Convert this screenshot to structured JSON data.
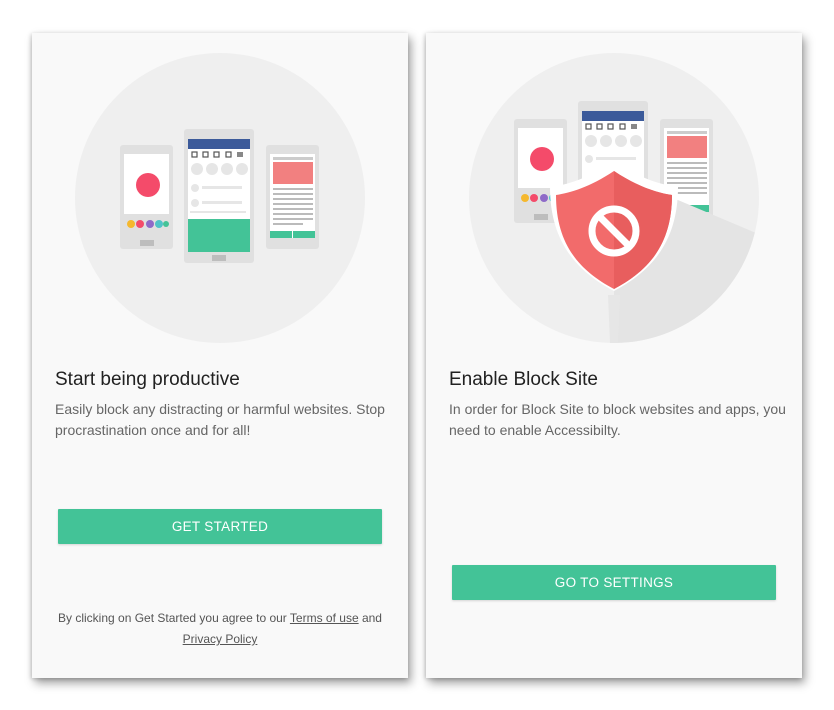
{
  "colors": {
    "accent": "#43c397",
    "panel_background": "#f9f9f9",
    "shield": "#f26b6b",
    "block_circle": "#f44b6a",
    "app_header": "#3b5a9a"
  },
  "left_screen": {
    "illustration_icon": "three-phones-illustration",
    "title": "Start being productive",
    "description": "Easily block any distracting or harmful websites. Stop procrastination once and for all!",
    "button_label": "GET STARTED",
    "terms": {
      "prefix": "By clicking on Get Started you agree to our ",
      "terms_link": "Terms of use",
      "middle": " and",
      "privacy_link": "Privacy Policy"
    }
  },
  "right_screen": {
    "illustration_icon": "phones-with-block-shield-illustration",
    "title": "Enable Block Site",
    "description": "In order for Block Site to block websites and apps, you need to enable Accessibilty.",
    "button_label": "GO TO SETTINGS"
  }
}
